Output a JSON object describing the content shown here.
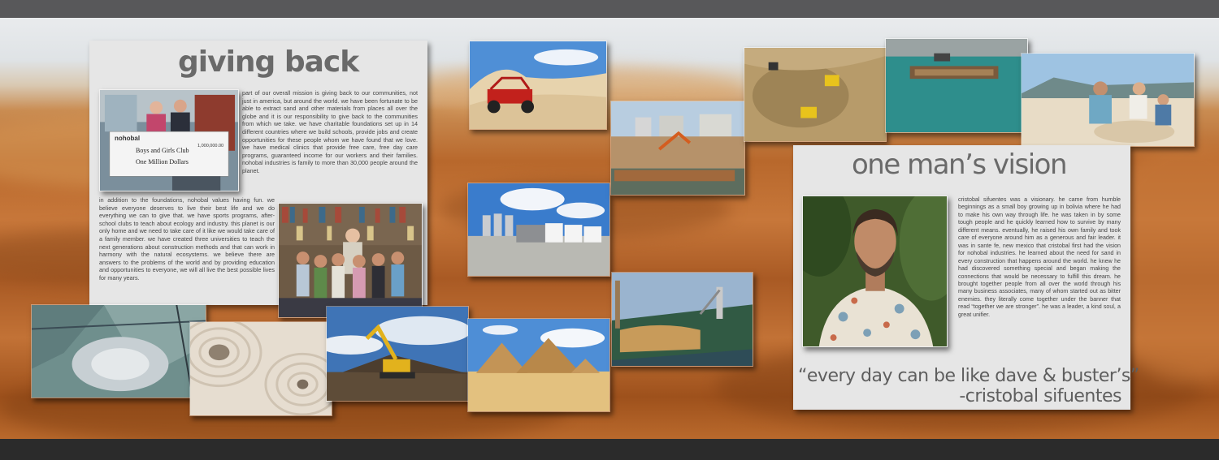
{
  "giving_back": {
    "title": "giving back",
    "paragraph1": "part of our overall mission is giving back to our communities, not just in america, but around the world. we have been fortunate to be able to extract sand and other materials from places all over the globe and it is our responsibility to give back to the communities from which we take. we have charitable foundations set up in 14 different countries where we build schools, provide jobs and create opportunities for these people whom we have found that we love. we have medical clinics that provide free care, free day care programs, guaranteed income for our workers and their families. nohobal industries is family to more than 30,000 people around the planet.",
    "paragraph2": "in addition to the foundations, nohobal values having fun. we believe everyone deserves to live their best life and we do everything we can to give that. we have sports programs, after-school clubs to teach about ecology and industry. this planet is our only home and we need to take care of it like we would take care of a family member. we have created three universities to teach the next generations about construction methods and that can work in harmony with the natural ecosystems. we believe there are answers to the problems of the world and by providing education and opportunities to everyone, we will all live the best possible lives for many years.",
    "check": {
      "brand": "nohobal",
      "payee": "Boys and Girls Club",
      "amount": "1,000,000.00",
      "amount_words": "One Million Dollars"
    }
  },
  "vision": {
    "title": "one man’s vision",
    "paragraph": "cristobal sifuentes was a visionary. he came from humble beginnings as a small boy growing up in bolivia where he had to make his own way through life. he was taken in by some tough people and he quickly learned how to survive by many different means. eventually, he raised his own family and took care of everyone around him as a generous and fair leader. it was in sante fe, new mexico that cristobal first had the vision for nohobal industries. he learned about the need for sand in every construction that happens around the world. he knew he had discovered something special and began making the connections that would be necessary to fulfill this dream. he brought together people from all over the world through his many business associates, many of whom started out as bitter enemies. they literally come together under the banner that read “together we are stronger”. he was a leader, a kind soul, a great unifier.",
    "quote": "“every day can be like dave & buster’s”",
    "attribution": "-cristobal sifuentes"
  },
  "colors": {
    "panel": "#e6e6e6",
    "title": "#6a6a6a",
    "top_bar": "#58585a",
    "bottom_bar": "#2b2b2b"
  }
}
